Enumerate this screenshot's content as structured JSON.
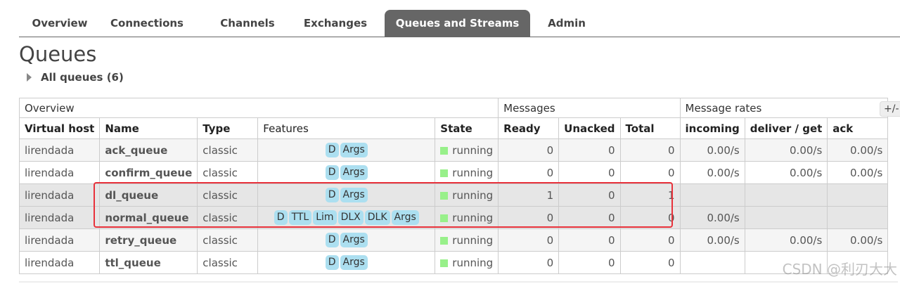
{
  "tabs": [
    {
      "label": "Overview"
    },
    {
      "label": "Connections"
    },
    {
      "label": "Channels"
    },
    {
      "label": "Exchanges"
    },
    {
      "label": "Queues and Streams",
      "active": true
    },
    {
      "label": "Admin"
    }
  ],
  "page_title": "Queues",
  "all_queues_label": "All queues (6)",
  "table": {
    "group_headers": {
      "overview": "Overview",
      "messages": "Messages",
      "rates": "Message rates"
    },
    "columns": {
      "vhost": "Virtual host",
      "name": "Name",
      "type": "Type",
      "features": "Features",
      "state": "State",
      "ready": "Ready",
      "unacked": "Unacked",
      "total": "Total",
      "incoming": "incoming",
      "deliver": "deliver / get",
      "ack": "ack"
    },
    "plus_minus": "+/-",
    "rows": [
      {
        "vhost": "lirendada",
        "name": "ack_queue",
        "type": "classic",
        "features": [
          "D",
          "Args"
        ],
        "state": "running",
        "ready": "0",
        "unacked": "0",
        "total": "0",
        "incoming": "0.00/s",
        "deliver": "0.00/s",
        "ack": "0.00/s"
      },
      {
        "vhost": "lirendada",
        "name": "confirm_queue",
        "type": "classic",
        "features": [
          "D",
          "Args"
        ],
        "state": "running",
        "ready": "0",
        "unacked": "0",
        "total": "0",
        "incoming": "0.00/s",
        "deliver": "0.00/s",
        "ack": "0.00/s"
      },
      {
        "vhost": "lirendada",
        "name": "dl_queue",
        "type": "classic",
        "features": [
          "D",
          "Args"
        ],
        "state": "running",
        "ready": "1",
        "unacked": "0",
        "total": "1",
        "incoming": "",
        "deliver": "",
        "ack": ""
      },
      {
        "vhost": "lirendada",
        "name": "normal_queue",
        "type": "classic",
        "features": [
          "D",
          "TTL",
          "Lim",
          "DLX",
          "DLK",
          "Args"
        ],
        "state": "running",
        "ready": "0",
        "unacked": "0",
        "total": "0",
        "incoming": "0.00/s",
        "deliver": "",
        "ack": ""
      },
      {
        "vhost": "lirendada",
        "name": "retry_queue",
        "type": "classic",
        "features": [
          "D",
          "Args"
        ],
        "state": "running",
        "ready": "0",
        "unacked": "0",
        "total": "0",
        "incoming": "0.00/s",
        "deliver": "0.00/s",
        "ack": "0.00/s"
      },
      {
        "vhost": "lirendada",
        "name": "ttl_queue",
        "type": "classic",
        "features": [
          "D",
          "Args"
        ],
        "state": "running",
        "ready": "0",
        "unacked": "0",
        "total": "0",
        "incoming": "",
        "deliver": "",
        "ack": ""
      }
    ]
  },
  "colors": {
    "active_tab": "#666666",
    "badge": "#acdff0",
    "running": "#98f08a",
    "highlight": "#e8323b"
  },
  "watermark": "CSDN @利刃大大"
}
